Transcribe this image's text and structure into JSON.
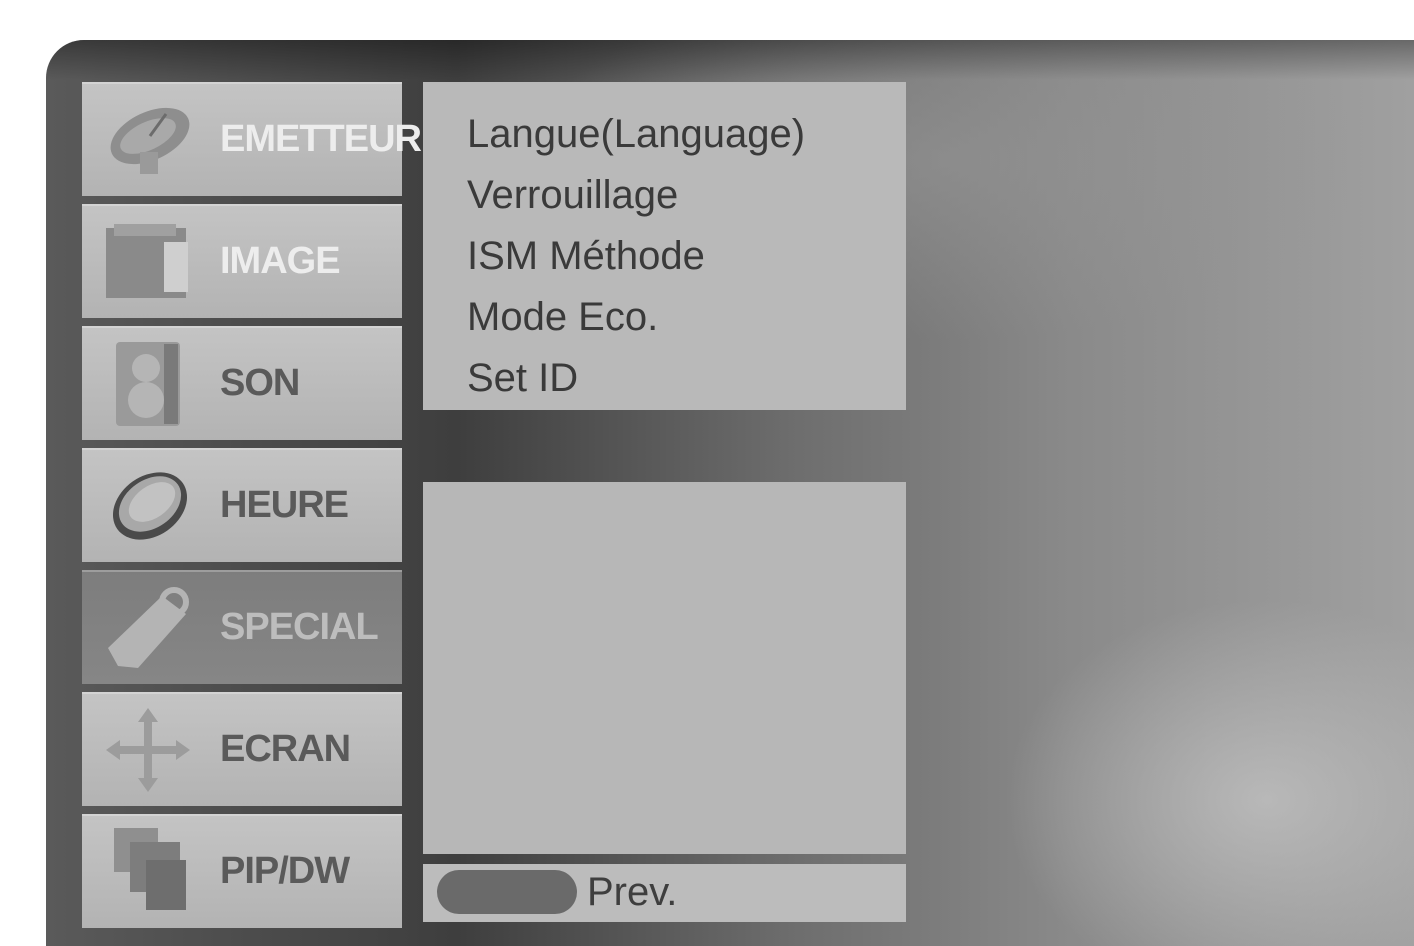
{
  "nav": {
    "items": [
      {
        "label": "EMETTEUR",
        "icon": "satellite-dish-icon"
      },
      {
        "label": "IMAGE",
        "icon": "picture-icon"
      },
      {
        "label": "SON",
        "icon": "speaker-icon"
      },
      {
        "label": "HEURE",
        "icon": "clock-icon"
      },
      {
        "label": "SPECIAL",
        "icon": "tag-icon"
      },
      {
        "label": "ECRAN",
        "icon": "move-arrows-icon"
      },
      {
        "label": "PIP/DW",
        "icon": "stacked-screens-icon"
      }
    ],
    "selected": "SPECIAL"
  },
  "submenu": {
    "items": [
      {
        "label": "Langue(Language)"
      },
      {
        "label": "Verrouillage"
      },
      {
        "label": "ISM Méthode"
      },
      {
        "label": "Mode Eco."
      },
      {
        "label": "Set ID"
      }
    ]
  },
  "footer": {
    "prev_label": "Prev."
  },
  "colors": {
    "panel": "#b9b9b9",
    "selected": "#7d7d7d",
    "text": "#3a3a3a"
  }
}
